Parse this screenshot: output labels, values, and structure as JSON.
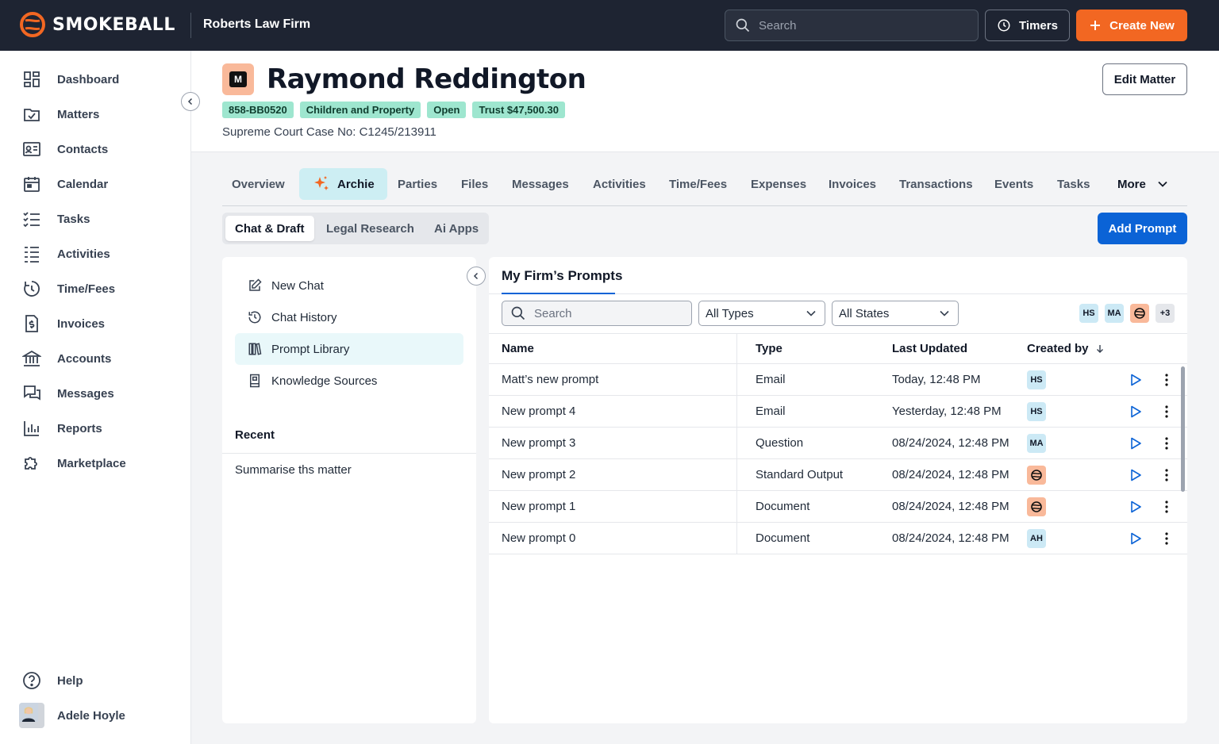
{
  "topbar": {
    "brand": "SMOKEBALL",
    "firm_name": "Roberts Law Firm",
    "search_placeholder": "Search",
    "timers_label": "Timers",
    "create_label": "Create New",
    "accent_color": "#f26722"
  },
  "sidebar": {
    "items": [
      {
        "label": "Dashboard",
        "icon": "dashboard-icon"
      },
      {
        "label": "Matters",
        "icon": "matters-icon"
      },
      {
        "label": "Contacts",
        "icon": "contacts-icon"
      },
      {
        "label": "Calendar",
        "icon": "calendar-icon"
      },
      {
        "label": "Tasks",
        "icon": "tasks-icon"
      },
      {
        "label": "Activities",
        "icon": "activities-icon"
      },
      {
        "label": "Time/Fees",
        "icon": "timer-icon"
      },
      {
        "label": "Invoices",
        "icon": "invoice-icon"
      },
      {
        "label": "Accounts",
        "icon": "bank-icon"
      },
      {
        "label": "Messages",
        "icon": "messages-icon"
      },
      {
        "label": "Reports",
        "icon": "reports-icon"
      },
      {
        "label": "Marketplace",
        "icon": "puzzle-icon"
      }
    ],
    "help_label": "Help",
    "user_name": "Adele Hoyle"
  },
  "matter": {
    "badge_letter": "M",
    "title": "Raymond Reddington",
    "tags": [
      "858-BB0520",
      "Children and Property",
      "Open",
      "Trust $47,500.30"
    ],
    "case_number": "Supreme Court Case No: C1245/213911",
    "edit_label": "Edit Matter"
  },
  "tabs": [
    "Overview",
    "Archie",
    "Parties",
    "Files",
    "Messages",
    "Activities",
    "Time/Fees",
    "Expenses",
    "Invoices",
    "Transactions",
    "Events",
    "Tasks",
    "More"
  ],
  "active_tab": "Archie",
  "subtabs": [
    "Chat & Draft",
    "Legal Research",
    "Ai Apps"
  ],
  "active_subtab": "Chat & Draft",
  "add_prompt_label": "Add Prompt",
  "left_panel": {
    "items": [
      {
        "label": "New Chat",
        "icon": "edit-icon"
      },
      {
        "label": "Chat History",
        "icon": "history-icon"
      },
      {
        "label": "Prompt Library",
        "icon": "library-icon"
      },
      {
        "label": "Knowledge Sources",
        "icon": "book-icon"
      }
    ],
    "active_item": "Prompt Library",
    "recent_title": "Recent",
    "recent_items": [
      "Summarise ths matter"
    ]
  },
  "prompts": {
    "title": "My Firm’s Prompts",
    "search_placeholder": "Search",
    "type_filter": "All Types",
    "state_filter": "All States",
    "avatars": [
      "HS",
      "MA",
      "logo",
      "+3"
    ],
    "columns": [
      "Name",
      "Type",
      "Last Updated",
      "Created by"
    ],
    "rows": [
      {
        "name": "Matt’s new prompt",
        "type": "Email",
        "updated": "Today, 12:48 PM",
        "creator": "HS"
      },
      {
        "name": "New prompt 4",
        "type": "Email",
        "updated": "Yesterday, 12:48 PM",
        "creator": "HS"
      },
      {
        "name": "New prompt 3",
        "type": "Question",
        "updated": "08/24/2024, 12:48 PM",
        "creator": "MA"
      },
      {
        "name": "New prompt 2",
        "type": "Standard Output",
        "updated": "08/24/2024, 12:48 PM",
        "creator": "logo"
      },
      {
        "name": "New prompt 1",
        "type": "Document",
        "updated": "08/24/2024, 12:48 PM",
        "creator": "logo"
      },
      {
        "name": "New prompt 0",
        "type": "Document",
        "updated": "08/24/2024, 12:48 PM",
        "creator": "AH"
      }
    ]
  }
}
